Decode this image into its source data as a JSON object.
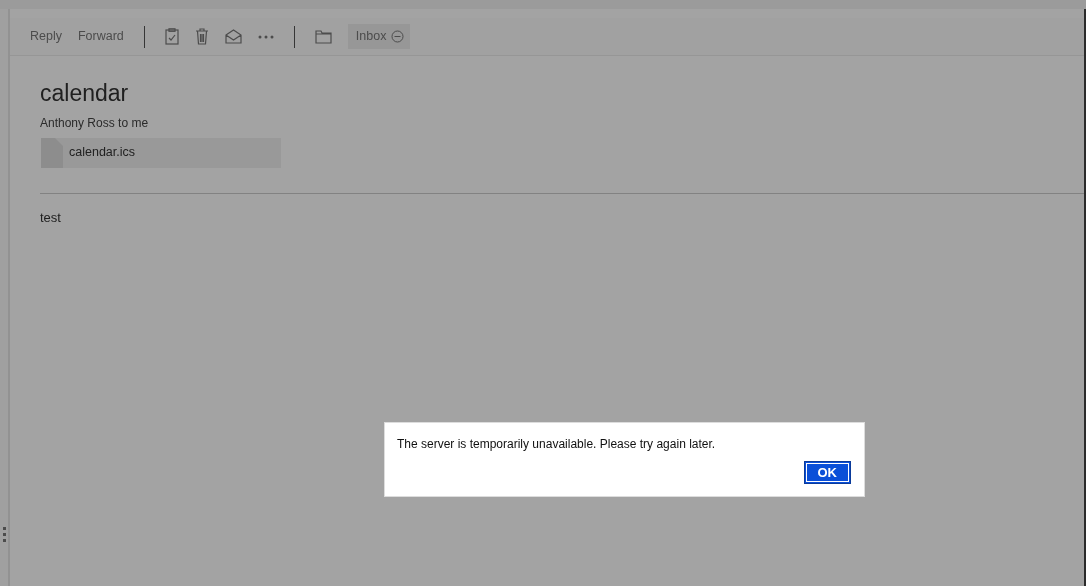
{
  "toolbar": [
    {
      "kind": "text",
      "label": "Reply"
    },
    {
      "kind": "text",
      "label": "Forward"
    },
    {
      "kind": "divider"
    },
    {
      "kind": "task"
    },
    {
      "kind": "delete"
    },
    {
      "kind": "read"
    },
    {
      "kind": "more"
    },
    {
      "kind": "divider"
    },
    {
      "kind": "folder"
    }
  ],
  "folder_tag": {
    "label": "Inbox"
  },
  "message": {
    "subject": "calendar",
    "from": "Anthony Ross to me",
    "attachments": [
      {
        "name": "calendar.ics"
      }
    ],
    "body": "test"
  },
  "dialog": {
    "text": "The server is temporarily unavailable. Please try again later.",
    "button": "OK"
  }
}
